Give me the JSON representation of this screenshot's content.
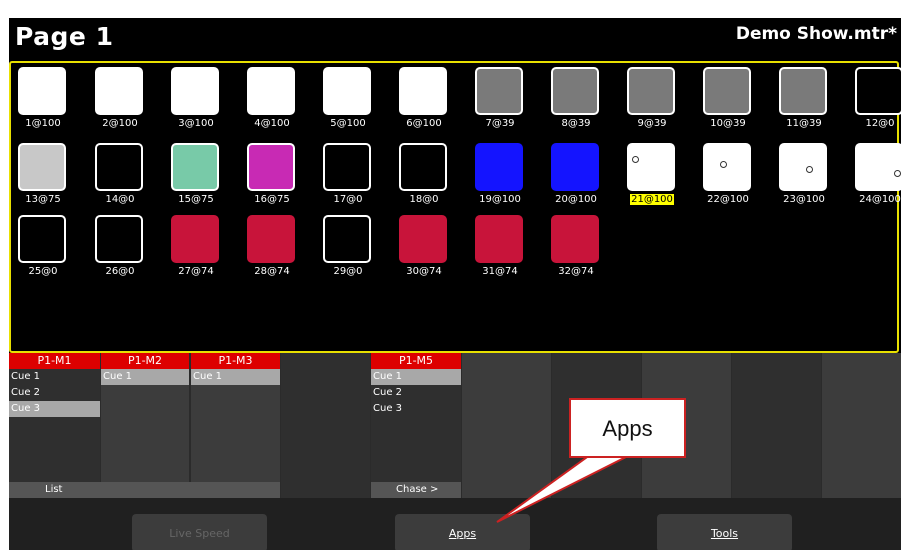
{
  "header": {
    "page_title": "Page 1",
    "show_name": "Demo Show.mtr*"
  },
  "fixtures": [
    {
      "label": "1@100",
      "color": "#ffffff",
      "outlined": false
    },
    {
      "label": "2@100",
      "color": "#ffffff",
      "outlined": false
    },
    {
      "label": "3@100",
      "color": "#ffffff",
      "outlined": false
    },
    {
      "label": "4@100",
      "color": "#ffffff",
      "outlined": false
    },
    {
      "label": "5@100",
      "color": "#ffffff",
      "outlined": false
    },
    {
      "label": "6@100",
      "color": "#ffffff",
      "outlined": false
    },
    {
      "label": "7@39",
      "color": "#7a7a7a",
      "outlined": true
    },
    {
      "label": "8@39",
      "color": "#7a7a7a",
      "outlined": true
    },
    {
      "label": "9@39",
      "color": "#7a7a7a",
      "outlined": true
    },
    {
      "label": "10@39",
      "color": "#7a7a7a",
      "outlined": true
    },
    {
      "label": "11@39",
      "color": "#7a7a7a",
      "outlined": true
    },
    {
      "label": "12@0",
      "color": "#000000",
      "outlined": true
    },
    {
      "label": "13@75",
      "color": "#c8c8c8",
      "outlined": true
    },
    {
      "label": "14@0",
      "color": "#000000",
      "outlined": true
    },
    {
      "label": "15@75",
      "color": "#78caa8",
      "outlined": true
    },
    {
      "label": "16@75",
      "color": "#c82ab4",
      "outlined": true
    },
    {
      "label": "17@0",
      "color": "#000000",
      "outlined": true
    },
    {
      "label": "18@0",
      "color": "#000000",
      "outlined": true
    },
    {
      "label": "19@100",
      "color": "#1414ff",
      "outlined": false
    },
    {
      "label": "20@100",
      "color": "#1414ff",
      "outlined": false
    },
    {
      "label": "21@100",
      "color": "#ffffff",
      "outlined": false,
      "highlight": true,
      "dot": [
        0.12,
        0.3
      ]
    },
    {
      "label": "22@100",
      "color": "#ffffff",
      "outlined": false,
      "dot": [
        0.38,
        0.4
      ]
    },
    {
      "label": "23@100",
      "color": "#ffffff",
      "outlined": false,
      "dot": [
        0.62,
        0.52
      ]
    },
    {
      "label": "24@100",
      "color": "#ffffff",
      "outlined": false,
      "dot": [
        0.88,
        0.62
      ]
    },
    {
      "label": "25@0",
      "color": "#000000",
      "outlined": true
    },
    {
      "label": "26@0",
      "color": "#000000",
      "outlined": true
    },
    {
      "label": "27@74",
      "color": "#c8143a",
      "outlined": false
    },
    {
      "label": "28@74",
      "color": "#c8143a",
      "outlined": false
    },
    {
      "label": "29@0",
      "color": "#000000",
      "outlined": true
    },
    {
      "label": "30@74",
      "color": "#c8143a",
      "outlined": false
    },
    {
      "label": "31@74",
      "color": "#c8143a",
      "outlined": false
    },
    {
      "label": "32@74",
      "color": "#c8143a",
      "outlined": false
    }
  ],
  "masters": {
    "m1": {
      "title": "P1-M1",
      "items": [
        "Cue 1",
        "Cue 2",
        "Cue 3"
      ],
      "footer": "List"
    },
    "m2": {
      "title": "P1-M2",
      "items": [
        "Cue 1"
      ]
    },
    "m3": {
      "title": "P1-M3",
      "items": [
        "Cue 1"
      ]
    },
    "m5": {
      "title": "P1-M5",
      "items": [
        "Cue 1",
        "Cue 2",
        "Cue 3"
      ],
      "footer": "Chase >"
    }
  },
  "toolbar": {
    "live_speed": "Live Speed",
    "apps": "Apps",
    "tools": "Tools"
  },
  "callout": {
    "text": "Apps"
  },
  "colors": {
    "grid_border": "#e8e000",
    "master_header": "#dd0000",
    "callout_border": "#cc2222"
  }
}
